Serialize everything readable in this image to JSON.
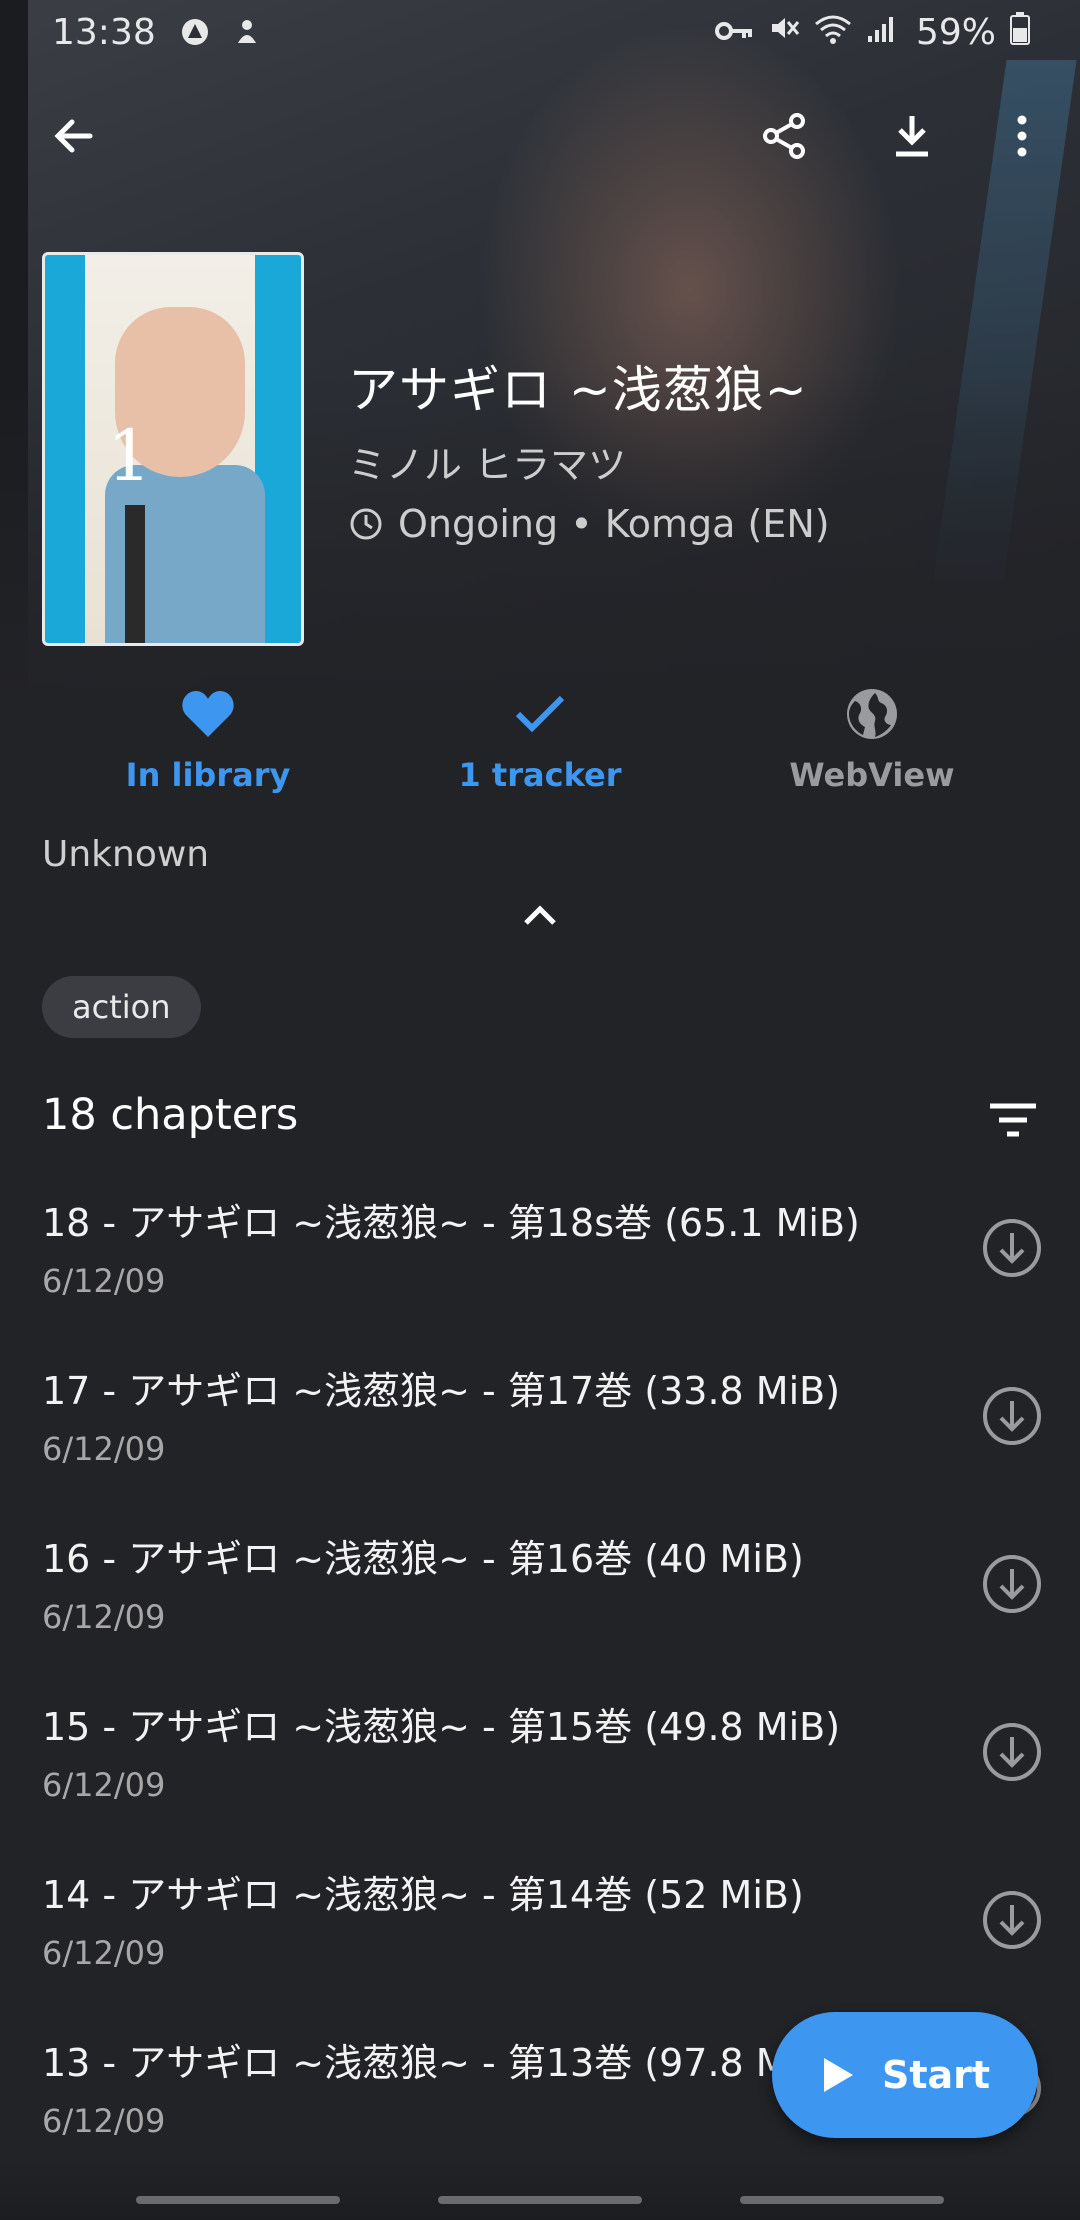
{
  "status_bar": {
    "time": "13:38",
    "battery": "59%",
    "left_icons": [
      "android-auto-icon",
      "notification-icon"
    ],
    "right_icons": [
      "vpn-key-icon",
      "mute-icon",
      "wifi-icon",
      "signal-icon",
      "battery-icon"
    ]
  },
  "toolbar": {
    "icons": [
      "back-arrow-icon",
      "share-icon",
      "download-icon",
      "overflow-menu-icon"
    ]
  },
  "manga": {
    "title": "アサギロ ~浅葱狼~",
    "author": "ミノル ヒラマツ",
    "status": "Ongoing • Komga (EN)"
  },
  "actions": {
    "library_label": "In library",
    "tracker_label": "1 tracker",
    "webview_label": "WebView"
  },
  "description": "Unknown",
  "genres": [
    "action"
  ],
  "chapters_header": "18 chapters",
  "chapters": [
    {
      "title": "18 - アサギロ ~浅葱狼~ - 第18s巻 (65.1 MiB)",
      "date": "6/12/09"
    },
    {
      "title": "17 - アサギロ ~浅葱狼~ - 第17巻 (33.8 MiB)",
      "date": "6/12/09"
    },
    {
      "title": "16 - アサギロ ~浅葱狼~ - 第16巻 (40 MiB)",
      "date": "6/12/09"
    },
    {
      "title": "15 - アサギロ ~浅葱狼~ - 第15巻 (49.8 MiB)",
      "date": "6/12/09"
    },
    {
      "title": "14 - アサギロ ~浅葱狼~ - 第14巻 (52 MiB)",
      "date": "6/12/09"
    },
    {
      "title": "13 - アサギロ ~浅葱狼~ - 第13巻 (97.8 MiB)",
      "date": "6/12/09"
    }
  ],
  "fab": {
    "label": "Start"
  },
  "colors": {
    "background": "#222327",
    "accent": "#3d97f0",
    "inactive": "#9a9b9e"
  }
}
